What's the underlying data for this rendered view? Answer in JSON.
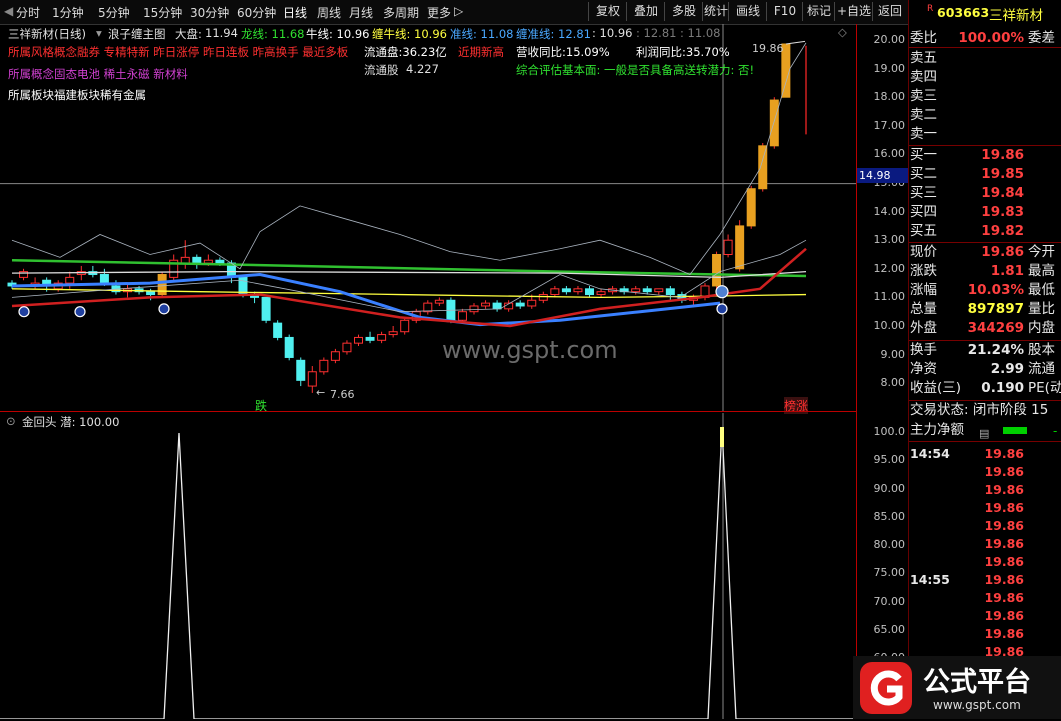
{
  "toolbar": {
    "periods": [
      "分时",
      "1分钟",
      "5分钟",
      "15分钟",
      "30分钟",
      "60分钟",
      "日线",
      "周线",
      "月线",
      "多周期",
      "更多"
    ],
    "actions": [
      "复权",
      "叠加",
      "多股",
      "统计",
      "画线",
      "F10",
      "标记",
      "+自选",
      "返回"
    ]
  },
  "main": {
    "stock_label": "三祥新材(日线)",
    "indicator_name": "浪子缠主图",
    "dapan_label": "大盘:",
    "dapan_value": "11.94",
    "longxian": "龙线: 11.68",
    "niuxian": "牛线: 10.96",
    "channiu": "缠牛线: 10.96",
    "zhunxian": "准线: 11.08",
    "chanzhun": "缠准线: 12.81",
    "v1": ": 10.96",
    "v2": ": 12.81",
    "v3": ": 11.08",
    "line1": "所属风格概念融券 专精特新 昨日涨停 昨日连板 昨高换手 最近多板",
    "liutongpan": "流通盘:36.23亿",
    "jinqi": "近期新高",
    "yingshou": "营收同比:15.09%",
    "lirun": "利润同比:35.70%",
    "line2": "所属概念固态电池 稀土永磁 新材料",
    "liutonggu_label": "流通股",
    "liutonggu_value": "4.227",
    "zonghe": "综合评估基本面: 一般是否具备高送转潜力: 否!",
    "line3": "所属板块福建板块稀有金属",
    "high_label": "19.86",
    "low_label": "7.66",
    "die_label": "跌",
    "bang_label": "榜涨",
    "watermark": "www.gspt.com",
    "cursor_price": "14.98",
    "yticks": [
      "20.00",
      "19.00",
      "18.00",
      "17.00",
      "16.00",
      "15.00",
      "14.00",
      "13.00",
      "12.00",
      "11.00",
      "10.00",
      "9.00",
      "8.00"
    ]
  },
  "indicator": {
    "title": "金回头 潜: 100.00",
    "yticks": [
      "100.0",
      "95.00",
      "90.00",
      "85.00",
      "80.00",
      "75.00",
      "70.00",
      "65.00",
      "60.00",
      "55.00",
      "50.00"
    ]
  },
  "quote": {
    "code": "603663",
    "name": "三祥新材",
    "weibi_label": "委比",
    "weibi_value": "100.00%",
    "weicha_label": "委差",
    "sells": [
      "卖五",
      "卖四",
      "卖三",
      "卖二",
      "卖一"
    ],
    "buys": [
      {
        "label": "买一",
        "price": "19.86"
      },
      {
        "label": "买二",
        "price": "19.85"
      },
      {
        "label": "买三",
        "price": "19.84"
      },
      {
        "label": "买四",
        "price": "19.83"
      },
      {
        "label": "买五",
        "price": "19.82"
      }
    ],
    "stats": [
      {
        "label": "现价",
        "value": "19.86",
        "extra": "今开",
        "color": "#ff4040"
      },
      {
        "label": "涨跌",
        "value": "1.81",
        "extra": "最高",
        "color": "#ff4040"
      },
      {
        "label": "涨幅",
        "value": "10.03%",
        "extra": "最低",
        "color": "#ff4040"
      },
      {
        "label": "总量",
        "value": "897897",
        "extra": "量比",
        "color": "#ffff40"
      },
      {
        "label": "外盘",
        "value": "344269",
        "extra": "内盘",
        "color": "#ff4040"
      }
    ],
    "stats2": [
      {
        "label": "换手",
        "value": "21.24%",
        "extra": "股本",
        "color": "#e8e8e8"
      },
      {
        "label": "净资",
        "value": "2.99",
        "extra": "流通",
        "color": "#e8e8e8"
      },
      {
        "label": "收益(三)",
        "value": "0.190",
        "extra": "PE(动",
        "color": "#e8e8e8"
      }
    ],
    "trade_status": "交易状态: 闭市阶段 15",
    "main_net": "主力净额",
    "ticks": [
      {
        "time": "14:54",
        "price": "19.86"
      },
      {
        "time": "",
        "price": "19.86"
      },
      {
        "time": "",
        "price": "19.86"
      },
      {
        "time": "",
        "price": "19.86"
      },
      {
        "time": "",
        "price": "19.86"
      },
      {
        "time": "",
        "price": "19.86"
      },
      {
        "time": "",
        "price": "19.86"
      },
      {
        "time": "14:55",
        "price": "19.86"
      },
      {
        "time": "",
        "price": "19.86"
      },
      {
        "time": "",
        "price": "19.86"
      },
      {
        "time": "",
        "price": "19.86"
      },
      {
        "time": "",
        "price": "19.86"
      },
      {
        "time": "",
        "price": "19.86"
      },
      {
        "time": "",
        "price": "19.86"
      }
    ]
  },
  "brand": {
    "name": "公式平台",
    "url": "www.gspt.com"
  },
  "colors": {
    "up": "#ff3030",
    "down": "#50f0f0",
    "bg": "#000000",
    "grid_red": "#aa0000"
  }
}
